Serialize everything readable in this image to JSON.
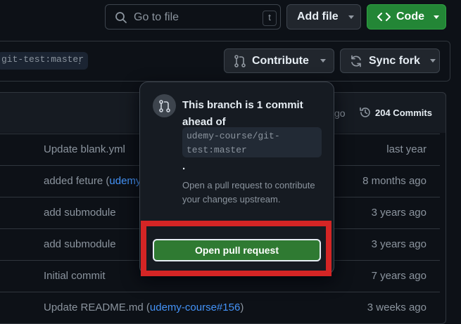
{
  "header": {
    "search_placeholder": "Go to file",
    "search_shortcut": "t",
    "add_file_label": "Add file",
    "code_label": "Code"
  },
  "branch_bar": {
    "branch_ref": "git-test:master",
    "trailing_period": ".",
    "contribute_label": "Contribute",
    "sync_fork_label": "Sync fork"
  },
  "table_header": {
    "age_fragment": "go",
    "commits_label": "204 Commits"
  },
  "rows": [
    {
      "message": "Update blank.yml",
      "link": "",
      "after": "",
      "time": "last year"
    },
    {
      "message": "added feture (",
      "link": "udemy",
      "after": "",
      "time": "8 months ago"
    },
    {
      "message": "add submodule",
      "link": "",
      "after": "",
      "time": "3 years ago"
    },
    {
      "message": "add submodule",
      "link": "",
      "after": "",
      "time": "3 years ago"
    },
    {
      "message": "Initial commit",
      "link": "",
      "after": "",
      "time": "7 years ago"
    },
    {
      "message": "Update README.md (",
      "link": "udemy-course#156",
      "after": ")",
      "time": "3 weeks ago"
    }
  ],
  "popover": {
    "title": "This branch is 1 commit ahead of",
    "branch_line1": "udemy-course/git-",
    "branch_line2": "test:master",
    "period": ".",
    "description": "Open a pull request to contribute your changes upstream.",
    "button_label": "Open pull request"
  },
  "colors": {
    "background": "#0d1117",
    "code_button": "#238636",
    "pr_button": "#2f7a32",
    "highlight": "#d42525",
    "link": "#4493f8"
  }
}
